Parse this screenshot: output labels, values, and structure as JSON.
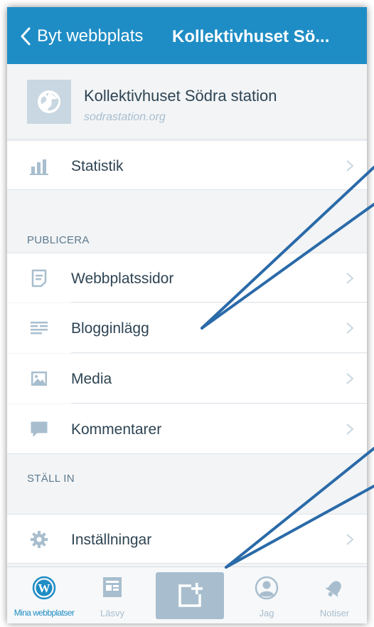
{
  "header": {
    "back_label": "Byt webbplats",
    "title": "Kollektivhuset Sö..."
  },
  "site": {
    "name": "Kollektivhuset Södra station",
    "url": "sodrastation.org",
    "icon": "globe-icon"
  },
  "stats": {
    "label": "Statistik",
    "icon": "stats-bars-icon"
  },
  "publish": {
    "header": "PUBLICERA",
    "items": [
      {
        "label": "Webbplatssidor",
        "icon": "page-icon"
      },
      {
        "label": "Blogginlägg",
        "icon": "posts-icon"
      },
      {
        "label": "Media",
        "icon": "image-icon"
      },
      {
        "label": "Kommentarer",
        "icon": "comment-icon"
      }
    ]
  },
  "configure": {
    "header": "STÄLL IN",
    "items": [
      {
        "label": "Inställningar",
        "icon": "gear-icon"
      }
    ]
  },
  "tabbar": {
    "items": [
      {
        "label": "Mina webbplatser",
        "icon": "wordpress-icon",
        "active": true
      },
      {
        "label": "Läsvy",
        "icon": "reader-icon",
        "active": false
      },
      {
        "label": "",
        "icon": "new-post-icon",
        "active": false
      },
      {
        "label": "Jag",
        "icon": "profile-icon",
        "active": false
      },
      {
        "label": "Notiser",
        "icon": "bell-icon",
        "active": false
      }
    ]
  },
  "colors": {
    "accent": "#1f8dc5",
    "background": "#f2f4f6",
    "text": "#2e4453",
    "muted": "#a8bece",
    "annotation": "#2a6aa8"
  }
}
